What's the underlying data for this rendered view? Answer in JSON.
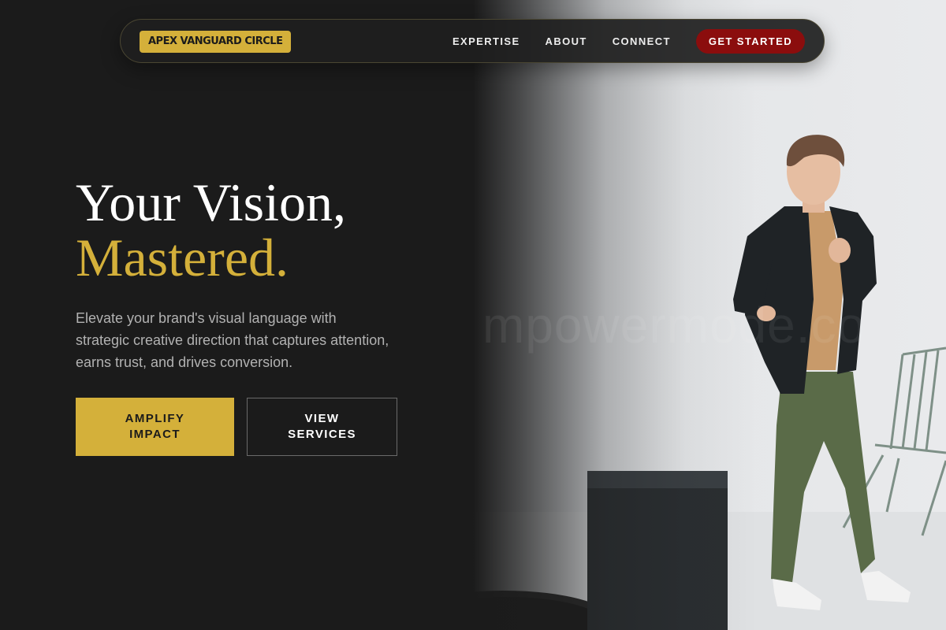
{
  "nav": {
    "logo": "APEX VANGUARD CIRCLE",
    "links": [
      "EXPERTISE",
      "ABOUT",
      "CONNECT"
    ],
    "cta": "GET STARTED"
  },
  "hero": {
    "headline_line1": "Your Vision,",
    "headline_line2": "Mastered.",
    "lede": "Elevate your brand's visual language with strategic creative direction that captures attention, earns trust, and drives conversion.",
    "primary_button": "AMPLIFY IMPACT",
    "secondary_button": "VIEW SERVICES",
    "watermark": "mpowermode.co"
  },
  "colors": {
    "background": "#1b1b1b",
    "accent_gold": "#d4b03a",
    "cta_red": "#8b0d0d",
    "muted_text": "#b2b2b2"
  }
}
